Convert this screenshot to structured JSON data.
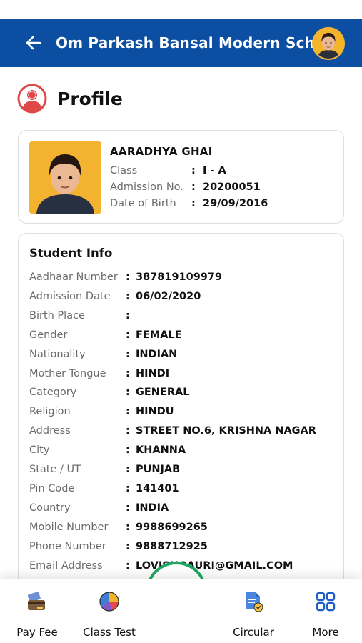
{
  "header": {
    "school_name": "Om Parkash Bansal Modern School",
    "bar_color": "#0b4ea2"
  },
  "page": {
    "title": "Profile"
  },
  "student_card": {
    "name": "AARADHYA GHAI",
    "rows": [
      {
        "label": "Class",
        "value": "I - A"
      },
      {
        "label": "Admission No.",
        "value": "20200051"
      },
      {
        "label": "Date of Birth",
        "value": "29/09/2016"
      }
    ]
  },
  "student_info": {
    "title": "Student Info",
    "rows": [
      {
        "label": "Aadhaar Number",
        "value": "387819109979"
      },
      {
        "label": "Admission Date",
        "value": "06/02/2020"
      },
      {
        "label": "Birth Place",
        "value": ""
      },
      {
        "label": "Gender",
        "value": "FEMALE"
      },
      {
        "label": "Nationality",
        "value": "INDIAN"
      },
      {
        "label": "Mother Tongue",
        "value": "HINDI"
      },
      {
        "label": "Category",
        "value": "GENERAL"
      },
      {
        "label": "Religion",
        "value": "HINDU"
      },
      {
        "label": "Address",
        "value": "STREET NO.6, KRISHNA NAGAR"
      },
      {
        "label": "City",
        "value": "KHANNA"
      },
      {
        "label": "State / UT",
        "value": "PUNJAB"
      },
      {
        "label": "Pin Code",
        "value": "141401"
      },
      {
        "label": "Country",
        "value": "INDIA"
      },
      {
        "label": "Mobile Number",
        "value": "9988699265"
      },
      {
        "label": "Phone Number",
        "value": "9888712925"
      },
      {
        "label": "Email Address",
        "value": "LOVISHGAURI@GMAIL.COM"
      }
    ]
  },
  "bottom_nav": {
    "items": [
      {
        "label": "Pay Fee",
        "icon": "pay-fee-icon"
      },
      {
        "label": "Class Test",
        "icon": "pie-chart-icon"
      },
      {
        "label": "Circular",
        "icon": "circular-document-icon"
      },
      {
        "label": "More",
        "icon": "grid-icon"
      }
    ],
    "center_icon": "bell-icon",
    "accent": "#1ba861"
  }
}
